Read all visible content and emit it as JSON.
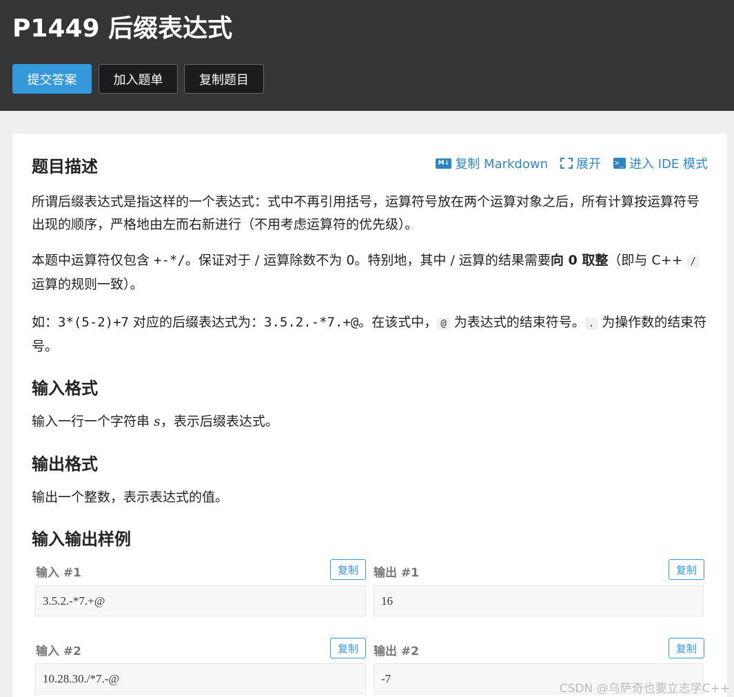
{
  "header": {
    "title": "P1449 后缀表达式",
    "buttons": {
      "submit": "提交答案",
      "add_to_list": "加入题单",
      "copy_problem": "复制题目"
    }
  },
  "toolbar": {
    "copy_markdown": "复制 Markdown",
    "expand": "展开",
    "ide_mode": "进入 IDE 模式",
    "md_icon_text": "M↓",
    "ide_icon_text": ">_"
  },
  "description": {
    "heading": "题目描述",
    "p1": "所谓后缀表达式是指这样的一个表达式：式中不再引用括号，运算符号放在两个运算对象之后，所有计算按运算符号出现的顺序，严格地由左而右新进行（不用考虑运算符的优先级）。",
    "p2_a": "本题中运算符仅包含 ",
    "p2_ops": "+-*/",
    "p2_b": "。保证对于 / 运算除数不为 0。特别地，其中 / 运算的结果需要",
    "p2_bold": "向 0 取整",
    "p2_c": "（即与 C++ ",
    "p2_code": "/",
    "p2_d": " 运算的规则一致）。",
    "p3_a": "如：",
    "p3_expr": "3*(5-2)+7",
    "p3_b": " 对应的后缀表达式为：",
    "p3_postfix": "3.5.2.-*7.+@",
    "p3_c": "。在该式中，",
    "p3_code1": "@",
    "p3_d": " 为表达式的结束符号。",
    "p3_code2": ".",
    "p3_e": " 为操作数的结束符号。"
  },
  "input_format": {
    "heading": "输入格式",
    "text_a": "输入一行一个字符串 ",
    "var": "s",
    "text_b": "，表示后缀表达式。"
  },
  "output_format": {
    "heading": "输出格式",
    "text": "输出一个整数，表示表达式的值。"
  },
  "samples": {
    "heading": "输入输出样例",
    "copy_label": "复制",
    "items": [
      {
        "in_label": "输入 #1",
        "in_value": "3.5.2.-*7.+@",
        "out_label": "输出 #1",
        "out_value": "16"
      },
      {
        "in_label": "输入 #2",
        "in_value": "10.28.30./*7.-@",
        "out_label": "输出 #2",
        "out_value": "-7"
      }
    ]
  },
  "watermark": "CSDN @乌萨奇也要立志学C++",
  "colors": {
    "header_bg": "#333537",
    "primary": "#3498db",
    "link": "#2e86c1"
  }
}
